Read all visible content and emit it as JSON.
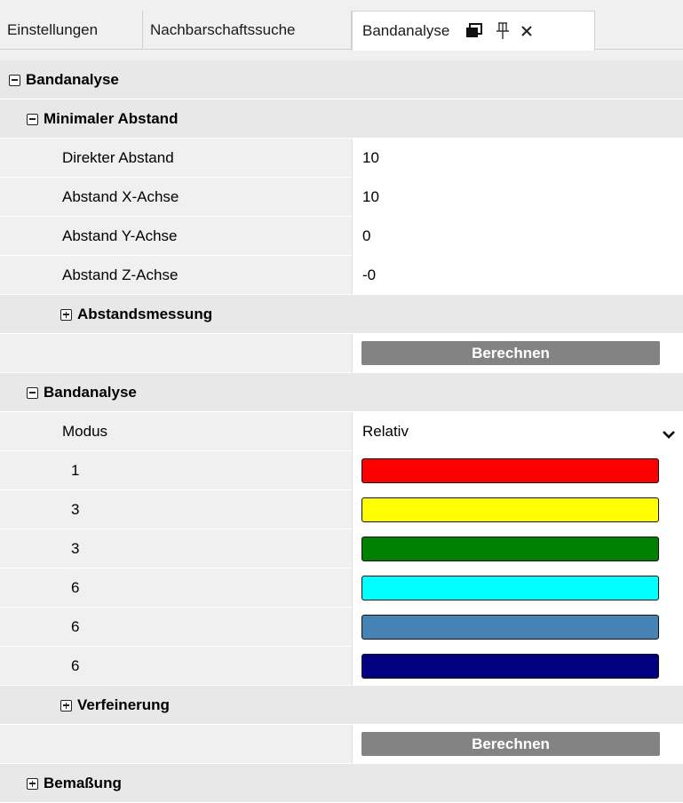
{
  "tabs": [
    {
      "label": "Einstellungen"
    },
    {
      "label": "Nachbarschaftssuche"
    },
    {
      "label": "Bandanalyse"
    }
  ],
  "tab_icons": [
    "float-window-icon",
    "pin-icon",
    "close-icon"
  ],
  "sections": {
    "root": {
      "label": "Bandanalyse",
      "expanded": true
    },
    "min_distance": {
      "label": "Minimaler Abstand",
      "expanded": true,
      "properties": [
        {
          "label": "Direkter Abstand",
          "value": "10"
        },
        {
          "label": "Abstand X-Achse",
          "value": "10"
        },
        {
          "label": "Abstand Y-Achse",
          "value": "0"
        },
        {
          "label": "Abstand Z-Achse",
          "value": "-0"
        }
      ],
      "sub": {
        "label": "Abstandsmessung",
        "expanded": false
      },
      "button_label": "Berechnen"
    },
    "band": {
      "label": "Bandanalyse",
      "expanded": true,
      "mode_label": "Modus",
      "mode_value": "Relativ",
      "bands": [
        {
          "label": "1",
          "color": "#ff0000"
        },
        {
          "label": "3",
          "color": "#ffff00"
        },
        {
          "label": "3",
          "color": "#008000"
        },
        {
          "label": "6",
          "color": "#00ffff"
        },
        {
          "label": "6",
          "color": "#4682b4"
        },
        {
          "label": "6",
          "color": "#000080"
        }
      ],
      "sub": {
        "label": "Verfeinerung",
        "expanded": false
      },
      "button_label": "Berechnen"
    },
    "dimension": {
      "label": "Bemaßung",
      "expanded": false
    }
  }
}
